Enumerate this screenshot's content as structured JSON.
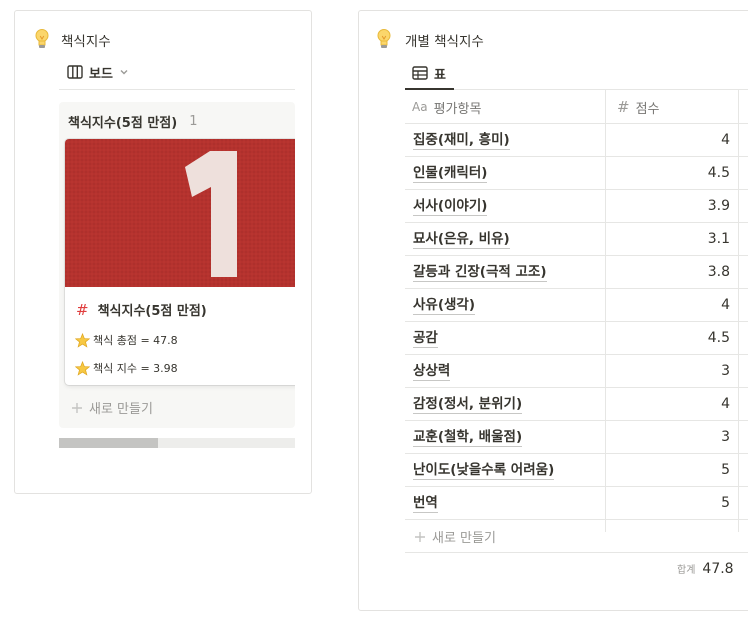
{
  "colors": {
    "accent_red": "#e03e3e",
    "border": "#e3e2e0",
    "muted_text": "#9b9a97",
    "text": "#37352f",
    "board_bg": "#f7f7f5",
    "cover_track_red": "#b5322e"
  },
  "left": {
    "icon": "lightbulb-icon",
    "title": "책식지수",
    "view_tab": {
      "icon": "board-icon",
      "label": "보드",
      "dropdown_icon": "chevron-down-icon"
    },
    "column": {
      "title": "책식지수(5점 만점)",
      "count": "1",
      "card": {
        "cover_icon": "running-track-number-one-image",
        "cover_number": "1",
        "title_icon": "hash-icon",
        "title": "책식지수(5점 만점)",
        "props": [
          {
            "icon": "star-icon",
            "text": "책식 총점 = 47.8"
          },
          {
            "icon": "star-icon",
            "text": "책식 지수 = 3.98"
          }
        ]
      },
      "new_label": "새로 만들기"
    }
  },
  "right": {
    "icon": "lightbulb-icon",
    "title": "개별 책식지수",
    "view_tab": {
      "icon": "table-icon",
      "label": "표"
    },
    "columns": {
      "name": "평가항목",
      "name_icon": "Aa",
      "score": "점수",
      "score_icon": "hash-icon"
    },
    "rows": [
      {
        "name": "집중(재미, 흥미)",
        "score": "4"
      },
      {
        "name": "인물(캐릭터)",
        "score": "4.5"
      },
      {
        "name": "서사(이야기)",
        "score": "3.9"
      },
      {
        "name": "묘사(은유, 비유)",
        "score": "3.1"
      },
      {
        "name": "갈등과 긴장(극적 고조)",
        "score": "3.8"
      },
      {
        "name": "사유(생각)",
        "score": "4"
      },
      {
        "name": "공감",
        "score": "4.5"
      },
      {
        "name": "상상력",
        "score": "3"
      },
      {
        "name": "감정(정서, 분위기)",
        "score": "4"
      },
      {
        "name": "교훈(철학, 배울점)",
        "score": "3"
      },
      {
        "name": "난이도(낮을수록 어려움)",
        "score": "5"
      },
      {
        "name": "번역",
        "score": "5"
      }
    ],
    "new_label": "새로 만들기",
    "sum_label": "합계",
    "sum_value": "47.8"
  }
}
